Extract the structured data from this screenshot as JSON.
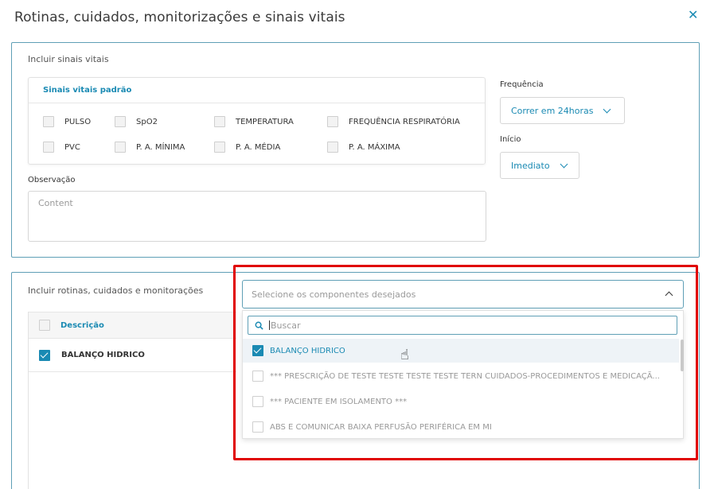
{
  "modal": {
    "title": "Rotinas, cuidados, monitorizações e sinais vitais",
    "close": "✕"
  },
  "vitals_section": {
    "title": "Incluir sinais vitais",
    "card_header": "Sinais vitais padrão",
    "items": [
      "PULSO",
      "SpO2",
      "TEMPERATURA",
      "FREQUÊNCIA RESPIRATÓRIA",
      "PVC",
      "P. A. MÍNIMA",
      "P. A. MÉDIA",
      "P. A. MÁXIMA"
    ],
    "observation_label": "Observação",
    "observation_placeholder": "Content",
    "frequency_label": "Frequência",
    "frequency_value": "Correr em 24horas",
    "start_label": "Início",
    "start_value": "Imediato"
  },
  "routines_section": {
    "title": "Incluir rotinas, cuidados e monitorações",
    "table_header": "Descrição",
    "rows": [
      "BALANÇO HIDRICO"
    ],
    "select_placeholder": "Selecione os componentes desejados",
    "search_placeholder": "Buscar",
    "options": [
      {
        "label": "BALANÇO HIDRICO",
        "checked": true
      },
      {
        "label": "*** PRESCRIÇÃO DE TESTE TESTE TESTE TESTE TERN CUIDADOS-PROCEDIMENTOS E MEDICAÇÃ...",
        "checked": false
      },
      {
        "label": "*** PACIENTE EM ISOLAMENTO ***",
        "checked": false
      },
      {
        "label": "ABS E COMUNICAR BAIXA PERFUSÃO PERIFÉRICA EM MI",
        "checked": false
      }
    ]
  },
  "colors": {
    "accent": "#1a8ab3",
    "panel_border": "#5f9fb6",
    "highlight": "#e00000"
  }
}
